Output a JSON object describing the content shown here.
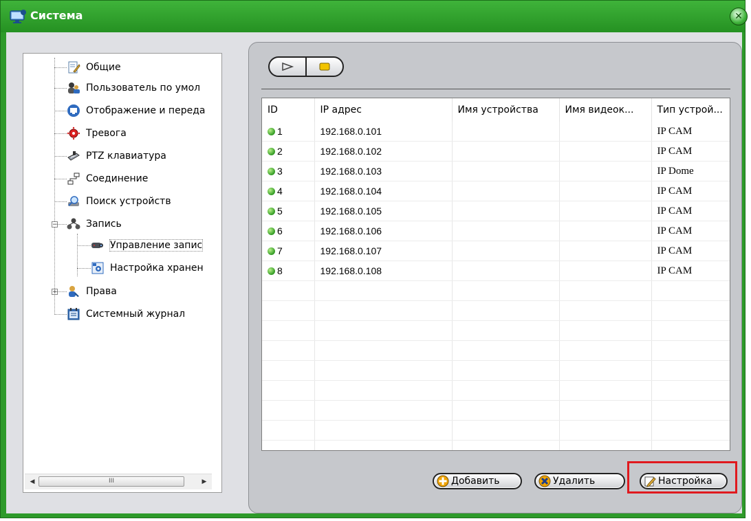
{
  "window": {
    "title": "Система"
  },
  "tree": {
    "items": [
      {
        "label": "Общие",
        "icon": "edit-document-icon"
      },
      {
        "label": "Пользователь по умол",
        "icon": "users-icon"
      },
      {
        "label": "Отображение и переда",
        "icon": "monitor-icon"
      },
      {
        "label": "Тревога",
        "icon": "alarm-icon"
      },
      {
        "label": "PTZ клавиатура",
        "icon": "ptz-keyboard-icon"
      },
      {
        "label": "Соединение",
        "icon": "network-icon"
      },
      {
        "label": "Поиск устройств",
        "icon": "device-search-icon"
      },
      {
        "label": "Запись",
        "icon": "record-group-icon",
        "expanded": true
      },
      {
        "label": "Управление запис",
        "icon": "camera-icon",
        "selected": true
      },
      {
        "label": "Настройка хранен",
        "icon": "storage-settings-icon"
      },
      {
        "label": "Права",
        "icon": "rights-icon",
        "collapsed": true
      },
      {
        "label": "Системный журнал",
        "icon": "system-log-icon"
      }
    ],
    "expander_collapse": "−",
    "expander_expand": "+",
    "scroll_left": "◀",
    "scroll_right": "▶",
    "scroll_grip": "III"
  },
  "toolbar": {
    "play_icon": "play-icon",
    "stop_icon": "stop-icon"
  },
  "table": {
    "columns": [
      "ID",
      "IP адрес",
      "Имя устройства",
      "Имя видеок...",
      "Тип устрой..."
    ],
    "rows": [
      {
        "id": "1",
        "ip": "192.168.0.101",
        "device": "",
        "video": "",
        "type": "IP CAM",
        "status": "online"
      },
      {
        "id": "2",
        "ip": "192.168.0.102",
        "device": "",
        "video": "",
        "type": "IP CAM",
        "status": "online"
      },
      {
        "id": "3",
        "ip": "192.168.0.103",
        "device": "",
        "video": "",
        "type": "IP Dome",
        "status": "online"
      },
      {
        "id": "4",
        "ip": "192.168.0.104",
        "device": "",
        "video": "",
        "type": "IP CAM",
        "status": "online"
      },
      {
        "id": "5",
        "ip": "192.168.0.105",
        "device": "",
        "video": "",
        "type": "IP CAM",
        "status": "online"
      },
      {
        "id": "6",
        "ip": "192.168.0.106",
        "device": "",
        "video": "",
        "type": "IP CAM",
        "status": "online"
      },
      {
        "id": "7",
        "ip": "192.168.0.107",
        "device": "",
        "video": "",
        "type": "IP CAM",
        "status": "online"
      },
      {
        "id": "8",
        "ip": "192.168.0.108",
        "device": "",
        "video": "",
        "type": "IP CAM",
        "status": "online"
      }
    ],
    "empty_rows": 9
  },
  "buttons": {
    "add": "Добавить",
    "delete": "Удалить",
    "settings": "Настройка"
  },
  "colors": {
    "frame": "#2e9a2a",
    "status_online": "#3aa12a",
    "highlight": "#e0191e"
  }
}
